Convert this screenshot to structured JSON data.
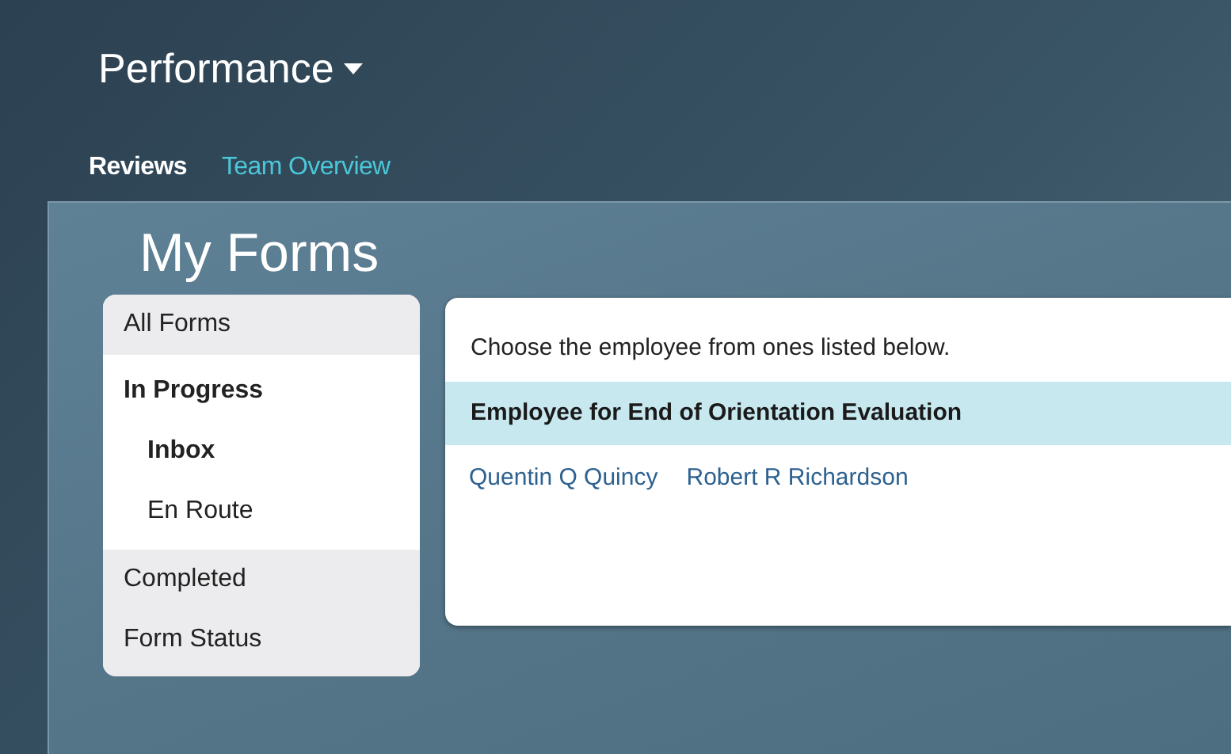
{
  "app_menu": {
    "title": "Performance",
    "has_caret": true
  },
  "tabs": [
    {
      "label": "Reviews",
      "selected": true
    },
    {
      "label": "Team Overview",
      "selected": false
    }
  ],
  "page_title": "My Forms",
  "sidebar": {
    "items": [
      {
        "label": "All Forms",
        "expanded": false
      },
      {
        "label": "In Progress",
        "expanded": true,
        "children": [
          {
            "label": "Inbox",
            "selected": true
          },
          {
            "label": "En Route",
            "selected": false
          }
        ]
      },
      {
        "label": "Completed",
        "expanded": false
      },
      {
        "label": "Form Status",
        "expanded": false
      }
    ]
  },
  "content": {
    "instruction": "Choose the employee from ones listed below.",
    "list_header": "Employee for End of Orientation Evaluation",
    "employees": [
      "Quentin Q Quincy",
      "Robert R Richardson"
    ]
  }
}
